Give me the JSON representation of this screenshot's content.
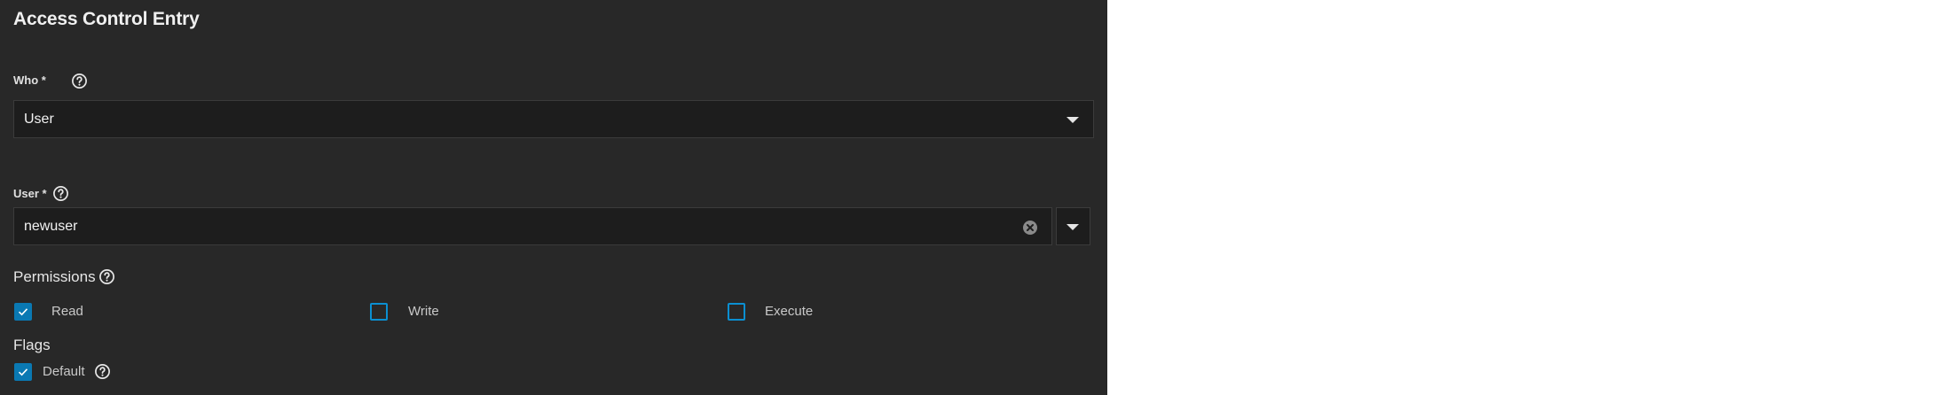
{
  "header": {
    "title": "Access Control Entry"
  },
  "who": {
    "label": "Who *",
    "value": "User"
  },
  "user": {
    "label": "User *",
    "value": "newuser"
  },
  "permissions": {
    "label": "Permissions",
    "items": [
      {
        "label": "Read",
        "checked": true
      },
      {
        "label": "Write",
        "checked": false
      },
      {
        "label": "Execute",
        "checked": false
      }
    ]
  },
  "flags": {
    "label": "Flags",
    "items": [
      {
        "label": "Default",
        "checked": true
      }
    ]
  },
  "colors": {
    "panel_bg": "#282828",
    "field_bg": "#1d1d1d",
    "accent": "#0a79b3"
  },
  "icons": {
    "help": "help-circle-icon",
    "clear": "clear-circle-icon",
    "caret": "caret-down-icon",
    "check": "checkmark-icon"
  }
}
